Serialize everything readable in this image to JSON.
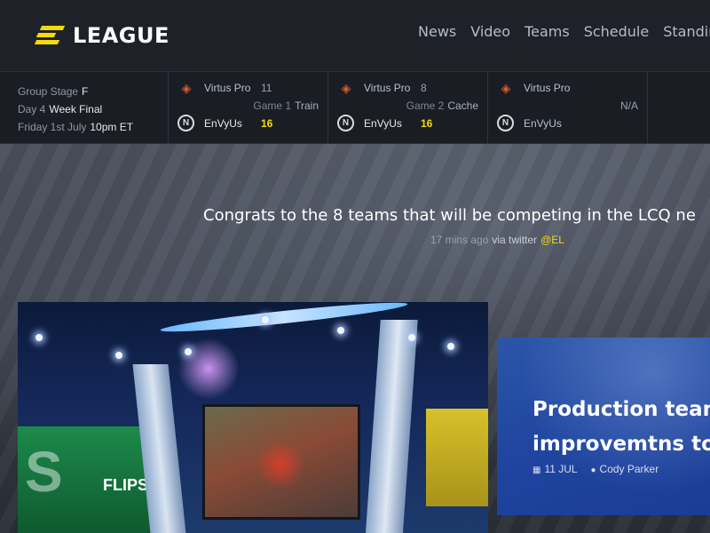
{
  "brand": {
    "name": "LEAGUE"
  },
  "nav": [
    {
      "label": "News"
    },
    {
      "label": "Video"
    },
    {
      "label": "Teams"
    },
    {
      "label": "Schedule"
    },
    {
      "label": "Standings"
    }
  ],
  "stage": {
    "group_label": "Group Stage",
    "group_value": "F",
    "day_label": "Day 4",
    "day_value": "Week Final",
    "date_label": "Friday 1st July",
    "date_value": "10pm ET"
  },
  "matches": [
    {
      "team1": {
        "name": "Virtus Pro",
        "score": "11"
      },
      "team2": {
        "name": "EnVyUs",
        "score": "16"
      },
      "game": "Game 1",
      "map": "Train",
      "status": ""
    },
    {
      "team1": {
        "name": "Virtus Pro",
        "score": "8"
      },
      "team2": {
        "name": "EnVyUs",
        "score": "16"
      },
      "game": "Game 2",
      "map": "Cache",
      "status": ""
    },
    {
      "team1": {
        "name": "Virtus Pro",
        "score": ""
      },
      "team2": {
        "name": "EnVyUs",
        "score": ""
      },
      "game": "",
      "map": "",
      "status": "N/A"
    }
  ],
  "tweet": {
    "text": "Congrats to the 8 teams that will be competing in the LCQ ne",
    "time": "17 mins ago",
    "via": "via twitter",
    "handle": "@EL"
  },
  "featured_image": {
    "wall_text": "FLIPS",
    "wall_letter": "S"
  },
  "article": {
    "title": "Production team improvemtns to e",
    "date": "11 JUL",
    "author": "Cody Parker"
  },
  "colors": {
    "accent": "#f5d90a",
    "background": "#1c2026",
    "article_card": "#1f45a0"
  }
}
